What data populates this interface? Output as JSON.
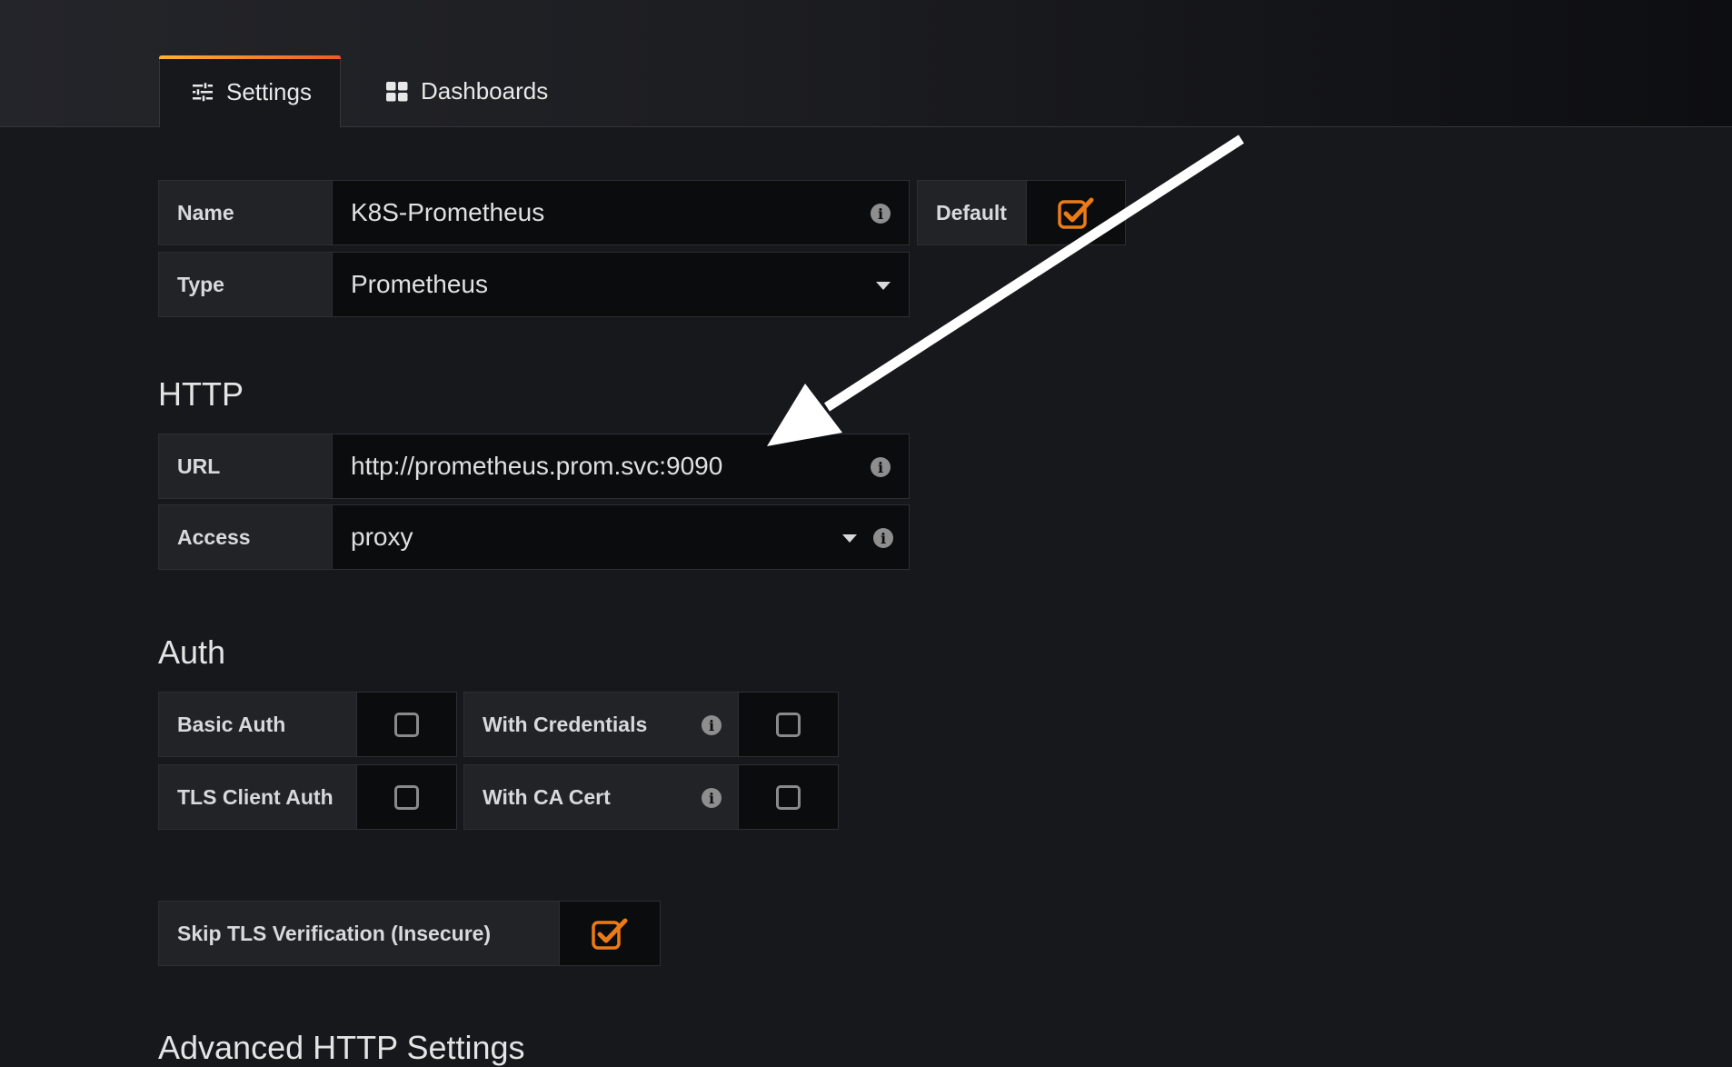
{
  "tabs": [
    {
      "label": "Settings",
      "icon": "sliders-icon",
      "active": true
    },
    {
      "label": "Dashboards",
      "icon": "grid-icon",
      "active": false
    }
  ],
  "basic": {
    "name_label": "Name",
    "name_value": "K8S-Prometheus",
    "default_label": "Default",
    "default_checked": true,
    "type_label": "Type",
    "type_value": "Prometheus"
  },
  "http": {
    "heading": "HTTP",
    "url_label": "URL",
    "url_value": "http://prometheus.prom.svc:9090",
    "access_label": "Access",
    "access_value": "proxy"
  },
  "auth": {
    "heading": "Auth",
    "basic_auth_label": "Basic Auth",
    "basic_auth_checked": false,
    "with_credentials_label": "With Credentials",
    "with_credentials_checked": false,
    "tls_client_auth_label": "TLS Client Auth",
    "tls_client_auth_checked": false,
    "with_ca_cert_label": "With CA Cert",
    "with_ca_cert_checked": false,
    "skip_tls_label": "Skip TLS Verification (Insecure)",
    "skip_tls_checked": true
  },
  "advanced": {
    "heading": "Advanced HTTP Settings"
  },
  "colors": {
    "accent": "#eb7b18",
    "background": "#17181c",
    "field": "#0b0c0e"
  }
}
